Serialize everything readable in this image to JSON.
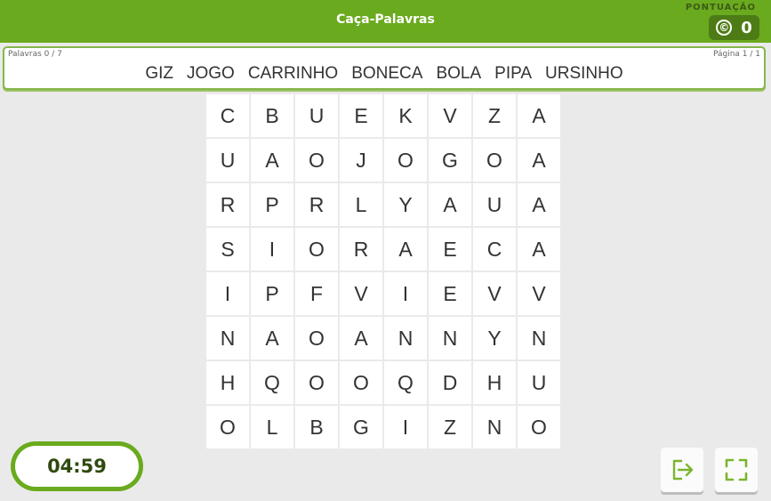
{
  "header": {
    "title": "Caça-Palavras",
    "score_label": "PONTUAÇÃO",
    "score_icon": "©",
    "score_value": "0"
  },
  "words_panel": {
    "count": "Palavras 0 / 7",
    "page": "Página 1 / 1",
    "words": [
      "GIZ",
      "JOGO",
      "CARRINHO",
      "BONECA",
      "BOLA",
      "PIPA",
      "URSINHO"
    ]
  },
  "grid": [
    [
      "C",
      "B",
      "U",
      "E",
      "K",
      "V",
      "Z",
      "A"
    ],
    [
      "U",
      "A",
      "O",
      "J",
      "O",
      "G",
      "O",
      "A"
    ],
    [
      "R",
      "P",
      "R",
      "L",
      "Y",
      "A",
      "U",
      "A"
    ],
    [
      "S",
      "I",
      "O",
      "R",
      "A",
      "E",
      "C",
      "A"
    ],
    [
      "I",
      "P",
      "F",
      "V",
      "I",
      "E",
      "V",
      "V"
    ],
    [
      "N",
      "A",
      "O",
      "A",
      "N",
      "N",
      "Y",
      "N"
    ],
    [
      "H",
      "Q",
      "O",
      "O",
      "Q",
      "D",
      "H",
      "U"
    ],
    [
      "O",
      "L",
      "B",
      "G",
      "I",
      "Z",
      "N",
      "O"
    ]
  ],
  "timer": {
    "value": "04:59"
  },
  "controls": {
    "exit_icon": "exit-icon",
    "fullscreen_icon": "fullscreen-icon"
  },
  "colors": {
    "accent": "#6aaa1e",
    "accent_dark": "#4d7c16",
    "background": "#eaeaea",
    "text": "#333333"
  }
}
